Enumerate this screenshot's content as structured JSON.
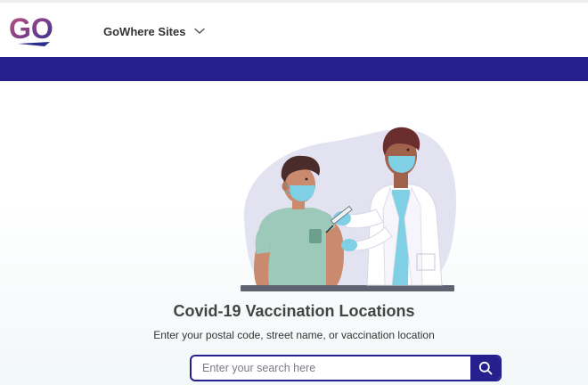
{
  "header": {
    "logo_text": "GO",
    "menu_label": "GoWhere Sites",
    "menu_icon": "chevron-down-icon"
  },
  "hero": {
    "illustration": "doctor-vaccinating-patient",
    "title": "Covid-19 Vaccination Locations",
    "subtitle": "Enter your postal code, street name, or vaccination location"
  },
  "search": {
    "placeholder": "Enter your search here",
    "value": "",
    "button_icon": "search-icon"
  },
  "colors": {
    "brand_band": "#25208e",
    "logo_gradient_start": "#b04a7a",
    "logo_gradient_end": "#2a2b8e"
  }
}
